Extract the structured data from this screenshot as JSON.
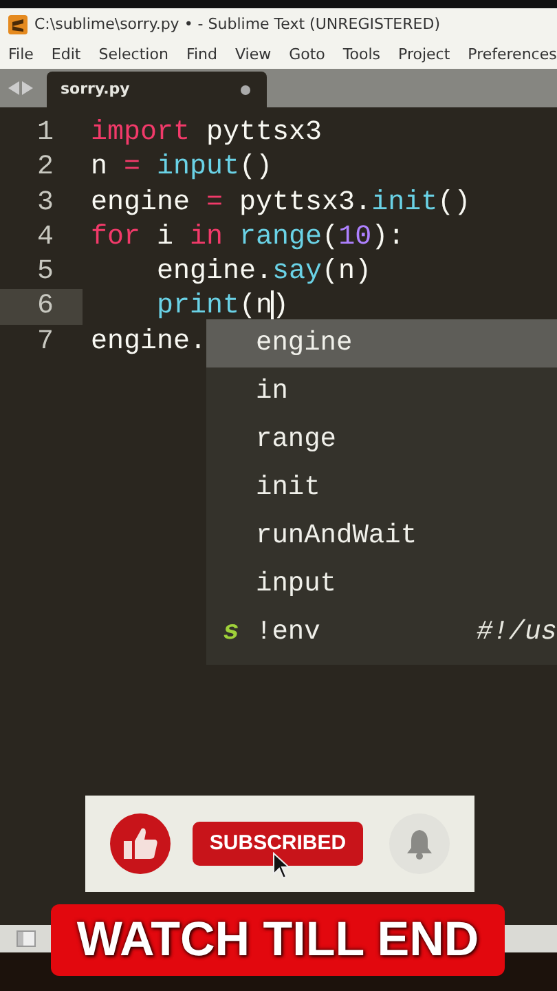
{
  "window": {
    "title": "C:\\sublime\\sorry.py • - Sublime Text (UNREGISTERED)"
  },
  "menu": [
    "File",
    "Edit",
    "Selection",
    "Find",
    "View",
    "Goto",
    "Tools",
    "Project",
    "Preferences"
  ],
  "tabs": [
    {
      "label": "sorry.py",
      "selected": true,
      "modified": true
    }
  ],
  "editor": {
    "lines": [
      {
        "number": "1",
        "current": false,
        "tokens": [
          {
            "kind": "keyword",
            "text": "import"
          },
          {
            "kind": "plain",
            "text": " pyttsx3"
          }
        ]
      },
      {
        "number": "2",
        "current": false,
        "tokens": [
          {
            "kind": "plain",
            "text": "n "
          },
          {
            "kind": "keyword",
            "text": "= "
          },
          {
            "kind": "builtin",
            "text": "input"
          },
          {
            "kind": "plain",
            "text": "()"
          }
        ]
      },
      {
        "number": "3",
        "current": false,
        "tokens": [
          {
            "kind": "plain",
            "text": "engine "
          },
          {
            "kind": "keyword",
            "text": "="
          },
          {
            "kind": "plain",
            "text": " pyttsx3."
          },
          {
            "kind": "builtin",
            "text": "init"
          },
          {
            "kind": "plain",
            "text": "()"
          }
        ]
      },
      {
        "number": "4",
        "current": false,
        "tokens": [
          {
            "kind": "keyword",
            "text": "for"
          },
          {
            "kind": "plain",
            "text": " i "
          },
          {
            "kind": "keyword",
            "text": "in "
          },
          {
            "kind": "builtin",
            "text": "range"
          },
          {
            "kind": "plain",
            "text": "("
          },
          {
            "kind": "number",
            "text": "10"
          },
          {
            "kind": "plain",
            "text": "):"
          }
        ]
      },
      {
        "number": "5",
        "current": false,
        "tokens": [
          {
            "kind": "plain",
            "text": "    engine."
          },
          {
            "kind": "builtin",
            "text": "say"
          },
          {
            "kind": "plain",
            "text": "(n)"
          }
        ]
      },
      {
        "number": "6",
        "current": true,
        "tokens": [
          {
            "kind": "builtin",
            "text": "    print"
          },
          {
            "kind": "plain",
            "text": "(n",
            "caret_after": true
          },
          {
            "kind": "plain",
            "text": ")"
          }
        ]
      },
      {
        "number": "7",
        "current": false,
        "tokens": [
          {
            "kind": "plain",
            "text": "engine."
          }
        ]
      }
    ]
  },
  "autocomplete": {
    "items": [
      {
        "label": "engine",
        "selected": true
      },
      {
        "label": "in",
        "selected": false
      },
      {
        "label": "range",
        "selected": false
      },
      {
        "label": "init",
        "selected": false
      },
      {
        "label": "runAndWait",
        "selected": false
      },
      {
        "label": "input",
        "selected": false
      },
      {
        "label": "!env",
        "selected": false,
        "badge": "s",
        "hint": "#!/us"
      }
    ]
  },
  "subscribe_overlay": {
    "button": "SUBSCRIBED"
  },
  "banner": "WATCH TILL END"
}
